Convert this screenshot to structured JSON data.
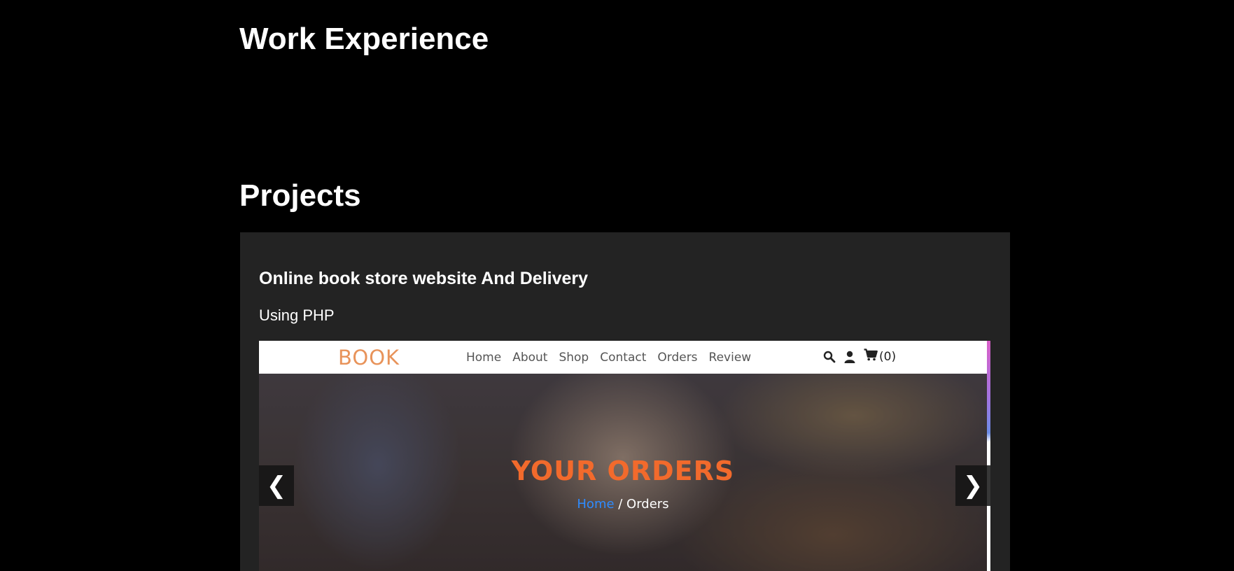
{
  "sections": {
    "work_experience_title": "Work Experience",
    "projects_title": "Projects"
  },
  "project": {
    "title": "Online book store website And Delivery",
    "tech": "Using PHP",
    "preview": {
      "logo": "BOOK",
      "nav": [
        "Home",
        "About",
        "Shop",
        "Contact",
        "Orders",
        "Review"
      ],
      "cart_count": "(0)",
      "hero_title": "YOUR ORDERS",
      "breadcrumb_home": "Home",
      "breadcrumb_rest": " / Orders"
    }
  },
  "carousel": {
    "prev_label": "❮",
    "next_label": "❯"
  },
  "colors": {
    "background": "#000000",
    "card": "#232323",
    "logo": "#e8935a",
    "hero_title": "#f26a2c",
    "breadcrumb_link": "#2e8bff"
  },
  "icons": [
    "search-icon",
    "user-icon",
    "cart-icon",
    "chevron-left-icon",
    "chevron-right-icon"
  ]
}
